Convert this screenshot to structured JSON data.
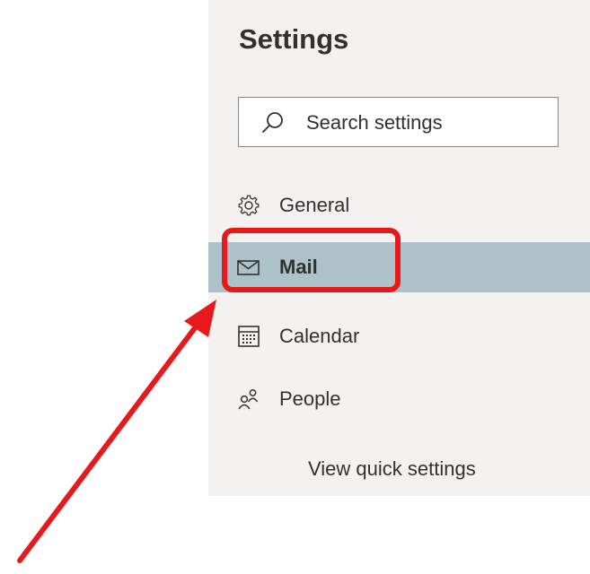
{
  "settings": {
    "title": "Settings",
    "search": {
      "placeholder": "Search settings",
      "icon": "search-icon"
    },
    "nav": [
      {
        "label": "General",
        "icon": "gear-icon",
        "selected": false
      },
      {
        "label": "Mail",
        "icon": "mail-icon",
        "selected": true
      },
      {
        "label": "Calendar",
        "icon": "calendar-icon",
        "selected": false
      },
      {
        "label": "People",
        "icon": "people-icon",
        "selected": false
      }
    ],
    "quick_settings_label": "View quick settings"
  },
  "colors": {
    "panel_bg": "#f3f2f1",
    "selected_bg": "#adc1c8",
    "annotation_red": "#e8191c",
    "text": "#323130"
  }
}
